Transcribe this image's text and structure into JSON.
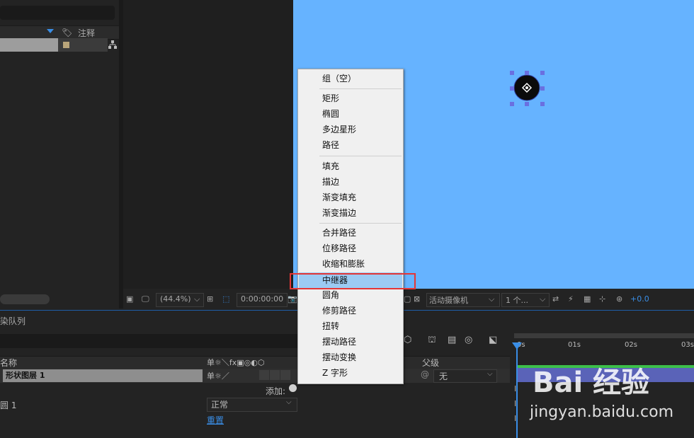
{
  "project": {
    "comment_header": "注释"
  },
  "viewer": {
    "zoom": "(44.4%)",
    "timecode": "0:00:00:00",
    "camera": "活动摄像机",
    "views": "1 个...",
    "exposure": "+0.0"
  },
  "panels": {
    "render_queue_tab": "染队列"
  },
  "timeline": {
    "col_name": "名称",
    "col_switches": "单☼＼fx▣◎◐⬡",
    "col_parent": "父级",
    "layer_name": "形状图层 1",
    "add_label": "添加:",
    "sub_item_label": "圆 1",
    "blend_mode": "正常",
    "reset_link": "重置",
    "parent_value": "无",
    "ruler_ticks": [
      "0s",
      "01s",
      "02s",
      "03s"
    ]
  },
  "context_menu": {
    "items": [
      {
        "label": "组（空）"
      },
      {
        "label": "矩形"
      },
      {
        "label": "椭圆"
      },
      {
        "label": "多边星形"
      },
      {
        "label": "路径"
      },
      {
        "label": "填充"
      },
      {
        "label": "描边"
      },
      {
        "label": "渐变填充"
      },
      {
        "label": "渐变描边"
      },
      {
        "label": "合并路径"
      },
      {
        "label": "位移路径"
      },
      {
        "label": "收缩和膨胀"
      },
      {
        "label": "中继器",
        "highlighted": true
      },
      {
        "label": "圆角"
      },
      {
        "label": "修剪路径"
      },
      {
        "label": "扭转"
      },
      {
        "label": "摆动路径"
      },
      {
        "label": "摆动变换"
      },
      {
        "label": "Z 字形"
      }
    ]
  },
  "watermark": {
    "logo": "Bai 经验",
    "url": "jingyan.baidu.com"
  },
  "colors": {
    "canvas": "#66b3ff",
    "highlight": "#9ccbf3",
    "annotation_box": "#e53535",
    "accent": "#3a8ee6"
  }
}
